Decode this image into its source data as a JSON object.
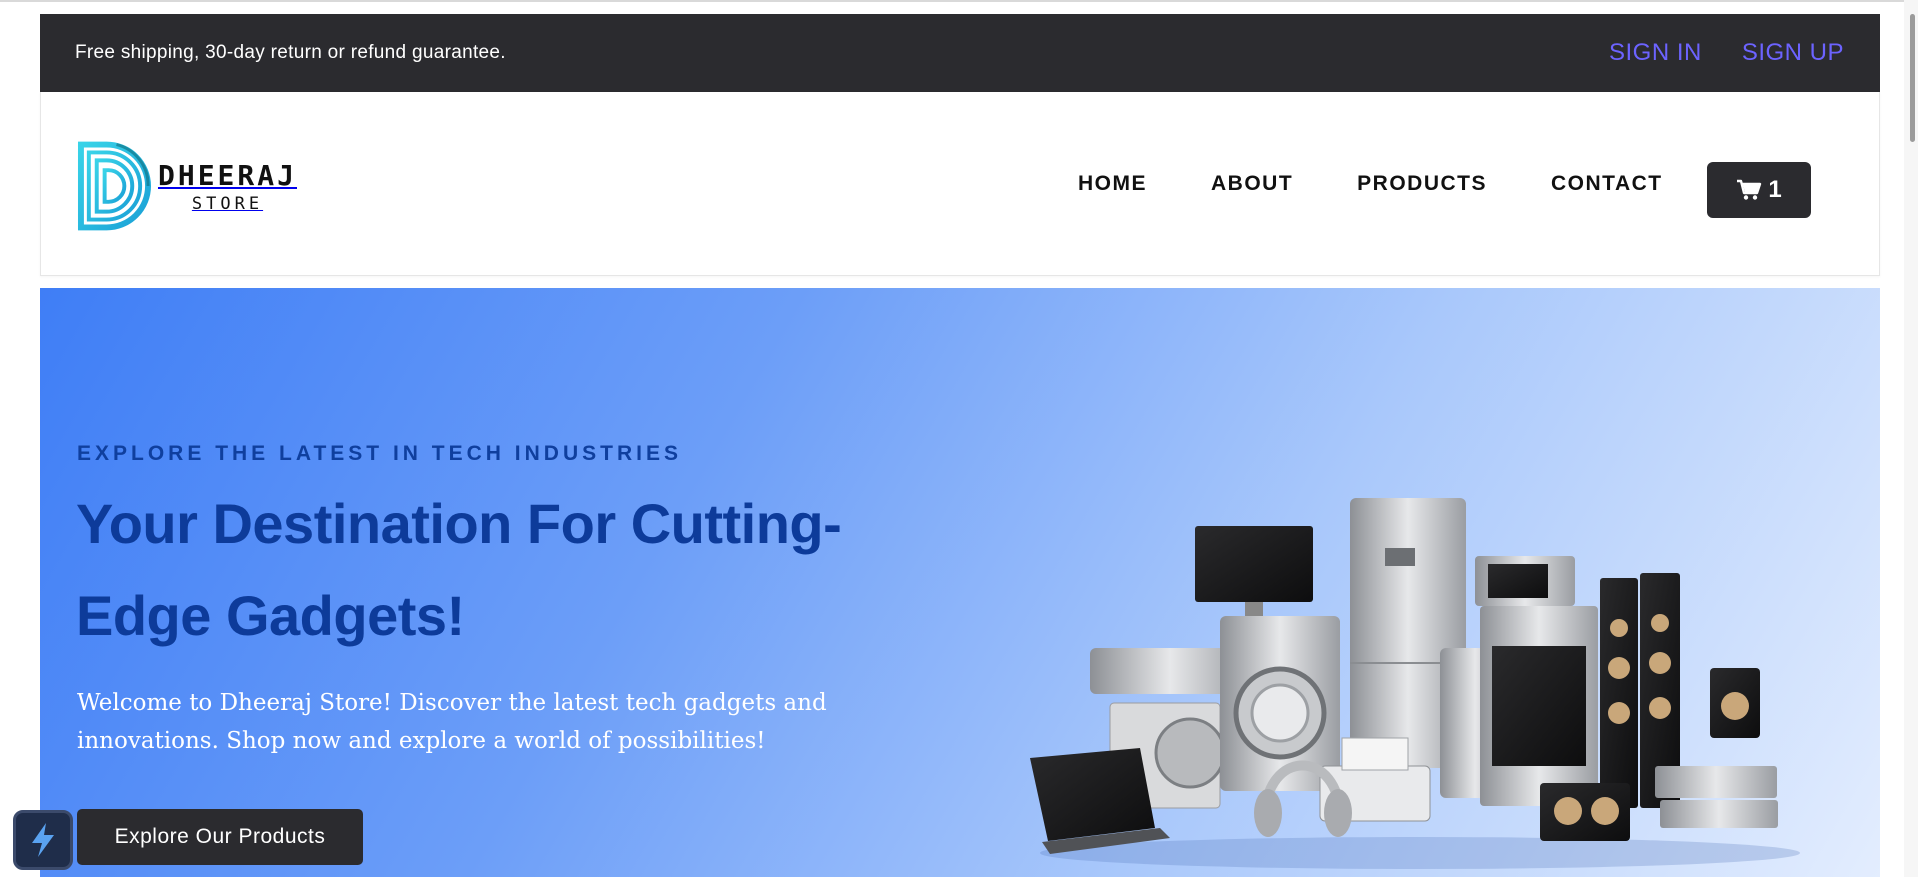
{
  "topbar": {
    "promo": "Free shipping, 30-day return or refund guarantee.",
    "sign_in": "SIGN IN",
    "sign_up": "SIGN UP",
    "auth_color": "#6c63ff"
  },
  "brand": {
    "line1": "DHEERAJ",
    "line2": "STORE",
    "logo_icon": "d-logo-icon"
  },
  "nav": {
    "items": [
      {
        "label": "HOME"
      },
      {
        "label": "ABOUT"
      },
      {
        "label": "PRODUCTS"
      },
      {
        "label": "CONTACT"
      }
    ],
    "cart_icon": "cart-icon",
    "cart_count": "1"
  },
  "hero": {
    "eyebrow": "EXPLORE THE LATEST IN TECH INDUSTRIES",
    "title": "Your Destination For Cutting-Edge Gadgets!",
    "lead": "Welcome to Dheeraj Store! Discover the latest tech gadgets and innovations. Shop now and explore a world of possibilities!",
    "cta": "Explore Our Products",
    "gradient": [
      "#3f7ef6",
      "#e3edfe"
    ],
    "title_color": "#0d3b9a"
  },
  "widget": {
    "icon": "bolt-icon"
  }
}
